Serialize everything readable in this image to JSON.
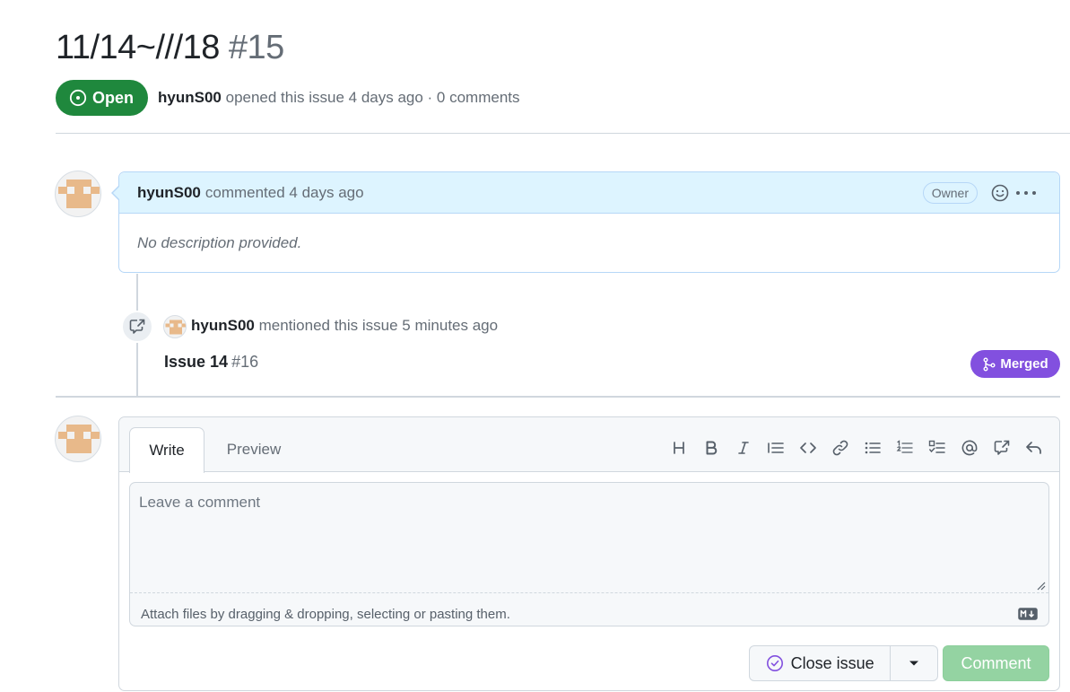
{
  "issue": {
    "title": "11/14~///18",
    "number": "#15",
    "state": "Open",
    "author": "hyunS00",
    "meta_suffix": "opened this issue 4 days ago · 0 comments"
  },
  "comment": {
    "author": "hyunS00",
    "action": "commented 4 days ago",
    "role_badge": "Owner",
    "body": "No description provided."
  },
  "event": {
    "author": "hyunS00",
    "action": "mentioned this issue 5 minutes ago",
    "ref_title": "Issue 14",
    "ref_number": "#16",
    "ref_state": "Merged"
  },
  "editor": {
    "tabs": [
      "Write",
      "Preview"
    ],
    "active_tab": "Write",
    "placeholder": "Leave a comment",
    "attach_hint": "Attach files by dragging & dropping, selecting or pasting them.",
    "toolbar": [
      "heading-icon",
      "bold-icon",
      "italic-icon",
      "quote-icon",
      "code-icon",
      "link-icon",
      "unordered-list-icon",
      "ordered-list-icon",
      "task-list-icon",
      "mention-icon",
      "cross-reference-icon",
      "reply-icon"
    ],
    "close_label": "Close issue",
    "comment_label": "Comment"
  },
  "colors": {
    "open_green": "#1f883d",
    "merged_purple": "#8250df",
    "comment_header_bg": "#ddf4ff",
    "comment_button_disabled": "#94d3a2"
  }
}
